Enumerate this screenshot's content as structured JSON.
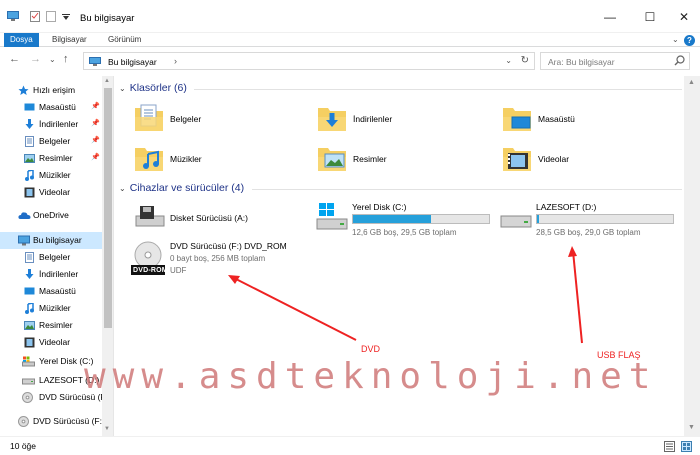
{
  "window": {
    "title": "Bu bilgisayar",
    "minimize": "—",
    "maximize": "☐",
    "close": "✕"
  },
  "ribbon": {
    "tabs": [
      "Dosya",
      "Bilgisayar",
      "Görünüm"
    ],
    "expand": "⌄",
    "help": "?"
  },
  "address": {
    "back": "←",
    "forward": "→",
    "recent": "⌄",
    "up": "↑",
    "path": "Bu bilgisayar",
    "sep": "›",
    "dropdown": "⌄",
    "refresh": "↻",
    "search_placeholder": "Ara: Bu bilgisayar"
  },
  "nav": {
    "quick_access": "Hızlı erişim",
    "quick_items": [
      "Masaüstü",
      "İndirilenler",
      "Belgeler",
      "Resimler",
      "Müzikler",
      "Videolar"
    ],
    "onedrive": "OneDrive",
    "this_pc": "Bu bilgisayar",
    "pc_items": [
      "Belgeler",
      "İndirilenler",
      "Masaüstü",
      "Müzikler",
      "Resimler",
      "Videolar",
      "Yerel Disk (C:)",
      "LAZESOFT (D:)",
      "DVD Sürücüsü (F:",
      "DVD Sürücüsü (F:)"
    ]
  },
  "folders": {
    "header": "Klasörler (6)",
    "items": [
      "Belgeler",
      "İndirilenler",
      "Masaüstü",
      "Müzikler",
      "Resimler",
      "Videolar"
    ]
  },
  "drives": {
    "header": "Cihazlar ve sürücüler (4)",
    "floppy": {
      "name": "Disket Sürücüsü (A:)"
    },
    "c": {
      "name": "Yerel Disk (C:)",
      "info": "12,6 GB boş, 29,5 GB toplam",
      "used_fraction": 0.573
    },
    "d": {
      "name": "LAZESOFT (D:)",
      "info": "28,5 GB boş, 29,0 GB toplam",
      "used_fraction": 0.017
    },
    "dvd": {
      "name": "DVD Sürücüsü (F:) DVD_ROM",
      "info": "0 bayt boş, 256 MB toplam",
      "fs": "UDF",
      "badge": "DVD-ROM"
    }
  },
  "status": {
    "count": "10 öğe"
  },
  "annotations": {
    "dvd": "DVD",
    "usb": "USB FLAŞ",
    "watermark": "www.asdteknoloji.net"
  },
  "colors": {
    "accent": "#1979ca",
    "bar_fill": "#26a0da",
    "annotation": "#ee2222",
    "header": "#1e3287"
  }
}
